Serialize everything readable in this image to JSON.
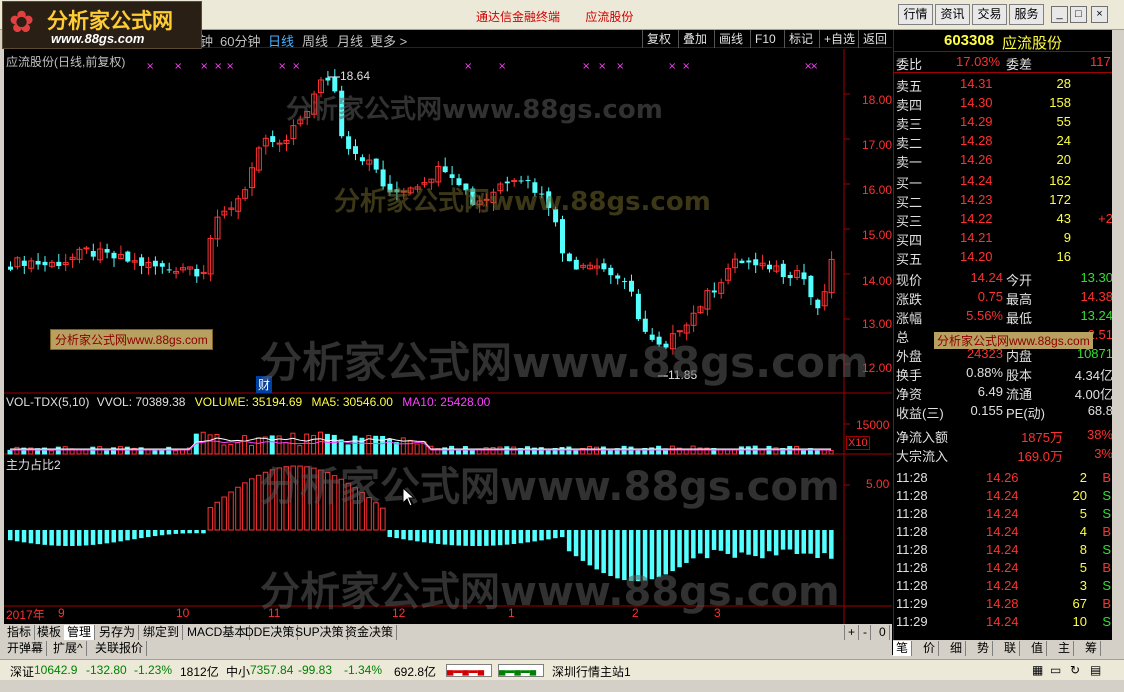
{
  "logo": {
    "name": "分析家公式网",
    "url": "www.88gs.com"
  },
  "title": {
    "app": "通达信金融终端",
    "stock": "应流股份"
  },
  "title_buttons": [
    "行情",
    "资讯",
    "交易",
    "服务"
  ],
  "periods": [
    "钟",
    "60分钟",
    "日线",
    "周线",
    "月线",
    "更多 >"
  ],
  "active_period": "日线",
  "right_buttons": [
    "复权",
    "叠加",
    "画线",
    "F10",
    "标记",
    "+自选",
    "返回"
  ],
  "chart": {
    "title": "应流股份(日线,前复权)",
    "high_label": "18.64",
    "low_label": "11.85",
    "fin_label": "财",
    "price_ticks": [
      "18.00",
      "17.00",
      "16.00",
      "15.00",
      "14.00",
      "13.00",
      "12.00"
    ],
    "vol_line": {
      "name": "VOL-TDX(5,10)",
      "vvol": "VVOL: 70389.38",
      "volume": "VOLUME: 35194.69",
      "ma5": "MA5: 30546.00",
      "ma10": "MA10: 25428.00"
    },
    "vol_tick": "15000",
    "vol_unit": "X10",
    "ind_title": "主力占比2",
    "ind_tick": "5.00",
    "watermark": "分析家公式网www.88gs.com",
    "overlay_label": "分析家公式网www.88gs.com",
    "dates": [
      "2017年",
      "9",
      "10",
      "11",
      "12",
      "1",
      "2",
      "3"
    ],
    "colors": {
      "up": "#ff3232",
      "down": "#54ffff",
      "ma5": "#ffffff",
      "ma10": "#ff40ff",
      "bg": "#000000"
    }
  },
  "panel": {
    "code": "603308",
    "name": "应流股份",
    "weibi": {
      "label": "委比",
      "value": "17.03%",
      "label2": "委差",
      "value2": "117"
    },
    "sells": [
      {
        "label": "卖五",
        "price": "14.31",
        "vol": "28"
      },
      {
        "label": "卖四",
        "price": "14.30",
        "vol": "158"
      },
      {
        "label": "卖三",
        "price": "14.29",
        "vol": "55"
      },
      {
        "label": "卖二",
        "price": "14.28",
        "vol": "24"
      },
      {
        "label": "卖一",
        "price": "14.26",
        "vol": "20"
      }
    ],
    "buys": [
      {
        "label": "买一",
        "price": "14.24",
        "vol": "162"
      },
      {
        "label": "买二",
        "price": "14.23",
        "vol": "172"
      },
      {
        "label": "买三",
        "price": "14.22",
        "vol": "43",
        "extra": "+2"
      },
      {
        "label": "买四",
        "price": "14.21",
        "vol": "9"
      },
      {
        "label": "买五",
        "price": "14.20",
        "vol": "16"
      }
    ],
    "quotes": [
      {
        "l1": "现价",
        "v1": "14.24",
        "c1": "red",
        "l2": "今开",
        "v2": "13.30",
        "c2": "grn"
      },
      {
        "l1": "涨跌",
        "v1": "0.75",
        "c1": "red",
        "l2": "最高",
        "v2": "14.38",
        "c2": "red"
      },
      {
        "l1": "涨幅",
        "v1": "5.56%",
        "c1": "red",
        "l2": "最低",
        "v2": "13.24",
        "c2": "grn"
      },
      {
        "l1": "总",
        "v1": "",
        "c1": "yel",
        "l2": "",
        "v2": "2.51",
        "c2": "red"
      },
      {
        "l1": "外盘",
        "v1": "24323",
        "c1": "red",
        "l2": "内盘",
        "v2": "10871",
        "c2": "grn"
      },
      {
        "l1": "换手",
        "v1": "0.88%",
        "c1": "wht",
        "l2": "股本",
        "v2": "4.34亿",
        "c2": "wht"
      },
      {
        "l1": "净资",
        "v1": "6.49",
        "c1": "wht",
        "l2": "流通",
        "v2": "4.00亿",
        "c2": "wht"
      },
      {
        "l1": "收益(三)",
        "v1": "0.155",
        "c1": "wht",
        "l2": "PE(动)",
        "v2": "68.8",
        "c2": "wht"
      }
    ],
    "flows": [
      {
        "label": "净流入额",
        "value": "1875万",
        "pct": "38%"
      },
      {
        "label": "大宗流入",
        "value": "169.0万",
        "pct": "3%"
      }
    ],
    "ticks": [
      {
        "time": "11:28",
        "price": "14.26",
        "vol": "2",
        "side": "B"
      },
      {
        "time": "11:28",
        "price": "14.24",
        "vol": "20",
        "side": "S"
      },
      {
        "time": "11:28",
        "price": "14.24",
        "vol": "5",
        "side": "S"
      },
      {
        "time": "11:28",
        "price": "14.24",
        "vol": "4",
        "side": "B"
      },
      {
        "time": "11:28",
        "price": "14.24",
        "vol": "8",
        "side": "S"
      },
      {
        "time": "11:28",
        "price": "14.24",
        "vol": "5",
        "side": "B"
      },
      {
        "time": "11:28",
        "price": "14.24",
        "vol": "3",
        "side": "S"
      },
      {
        "time": "11:29",
        "price": "14.28",
        "vol": "67",
        "side": "B"
      },
      {
        "time": "11:29",
        "price": "14.24",
        "vol": "10",
        "side": "S"
      }
    ]
  },
  "tabs": [
    "指标",
    "模板",
    "管理",
    "另存为",
    "绑定到",
    "MACD基本",
    "DDE决策",
    "SUP决策",
    "资金决策"
  ],
  "active_tab": "管理",
  "subtabs": [
    "开弹幕",
    "扩展^",
    "关联报价"
  ],
  "zoom_controls": [
    "+",
    "-",
    "0"
  ],
  "right_tabs": [
    "笔",
    "价",
    "细",
    "势",
    "联",
    "值",
    "主",
    "筹"
  ],
  "status": {
    "sz_label": "深证",
    "sz_value": "10642.9",
    "sz_change": "-132.80",
    "sz_pct": "-1.23%",
    "sz_amount": "1812亿",
    "zx_label": "中小",
    "zx_value": "7357.84",
    "zx_change": "-99.83",
    "zx_pct": "-1.34%",
    "zx_amount": "692.8亿",
    "server": "深圳行情主站1"
  }
}
